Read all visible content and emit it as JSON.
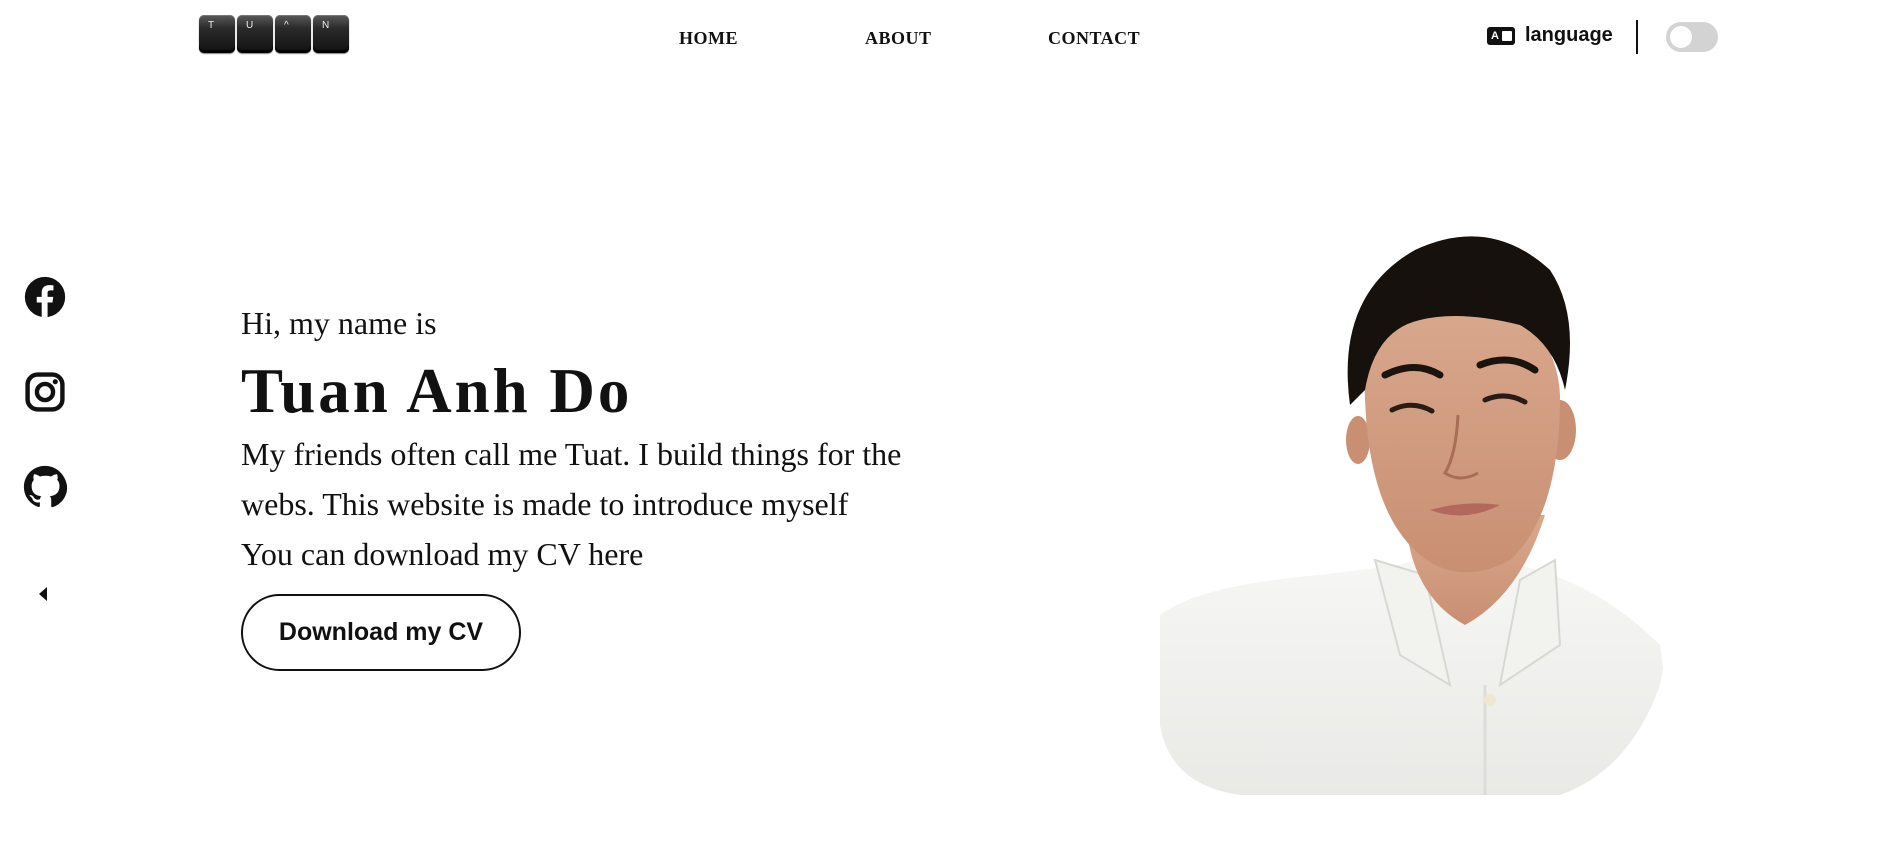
{
  "header": {
    "logo_letters": [
      "T",
      "U",
      "^",
      "N"
    ],
    "nav": [
      "HOME",
      "ABOUT",
      "CONTACT"
    ],
    "language_label": "language",
    "language_icon_text": "A",
    "theme_toggle": "off"
  },
  "social": {
    "items": [
      {
        "name": "facebook",
        "icon": "facebook-icon"
      },
      {
        "name": "instagram",
        "icon": "instagram-icon"
      },
      {
        "name": "github",
        "icon": "github-icon"
      }
    ],
    "collapse_icon": "caret-left-icon"
  },
  "hero": {
    "greeting": "Hi, my name is",
    "name": "Tuan Anh Do",
    "bio_line1": "My friends often call me Tuat. I build things for the",
    "bio_line2": "webs. This website is made to introduce myself",
    "bio_line3": "You can download my CV here",
    "cta_label": "Download my CV"
  },
  "colors": {
    "text": "#111111",
    "background": "#ffffff",
    "toggle_track": "#d3d3d3"
  }
}
